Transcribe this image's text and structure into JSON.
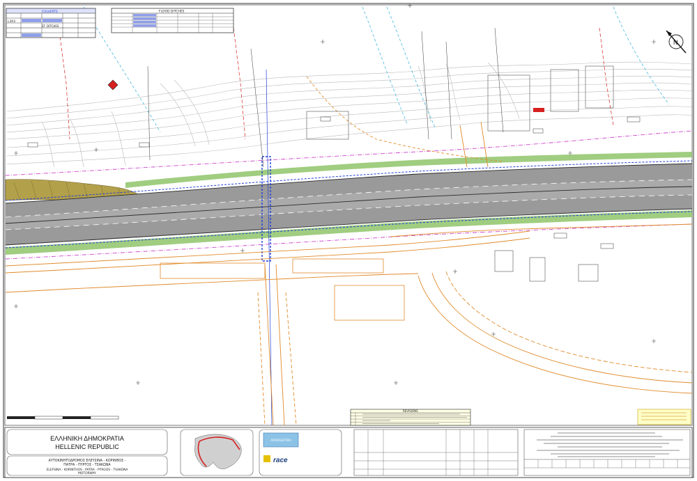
{
  "title_block": {
    "country_greek": "ΕΛΛΗΝΙΚΗ ΔΗΜΟΚΡΑΤΙΑ",
    "country_english": "HELLENIC REPUBLIC",
    "project_greek_line1": "ΑΥΤΟΚΙΝΗΤΟΔΡΟΜΟΣ ΕΛΕΥΣΙΝΑ - ΚΟΡΙΝΘΟΣ -",
    "project_greek_line2": "ΠΑΤΡΑ - ΠΥΡΓΟΣ - ΤΣΑΚΩΝΑ",
    "project_english_line1": "ELEFSINA - KORINTHOS - PATRA - PYRGOS - TSAKONA",
    "project_english_line2": "MOTORWAY",
    "contractor_logo_text": "ΑΠΟΚΛΕΙΣΤΙΚΑ",
    "designer_logo_text": "race"
  },
  "tables": {
    "top_left_title": "CULVERTS",
    "top_left_subtitle": "ST. DITCHES",
    "top_left_row_label": "L303",
    "flood_table_title": "FLOOD DITCHES"
  },
  "revisions": {
    "title": "REVISIONS"
  },
  "north_arrow_letter": "N",
  "colors": {
    "road_gray": "#9a9a9a",
    "contour_gray": "#b9b9b9",
    "utility_orange": "#e08a2a",
    "fence_magenta": "#cc44cc",
    "culvert_blue": "#1f3fd6",
    "drain_cyan": "#45b8e0",
    "grid_red": "#d62020",
    "embankment_green": "#8fc46a",
    "cut_olive": "#b3a04a"
  }
}
